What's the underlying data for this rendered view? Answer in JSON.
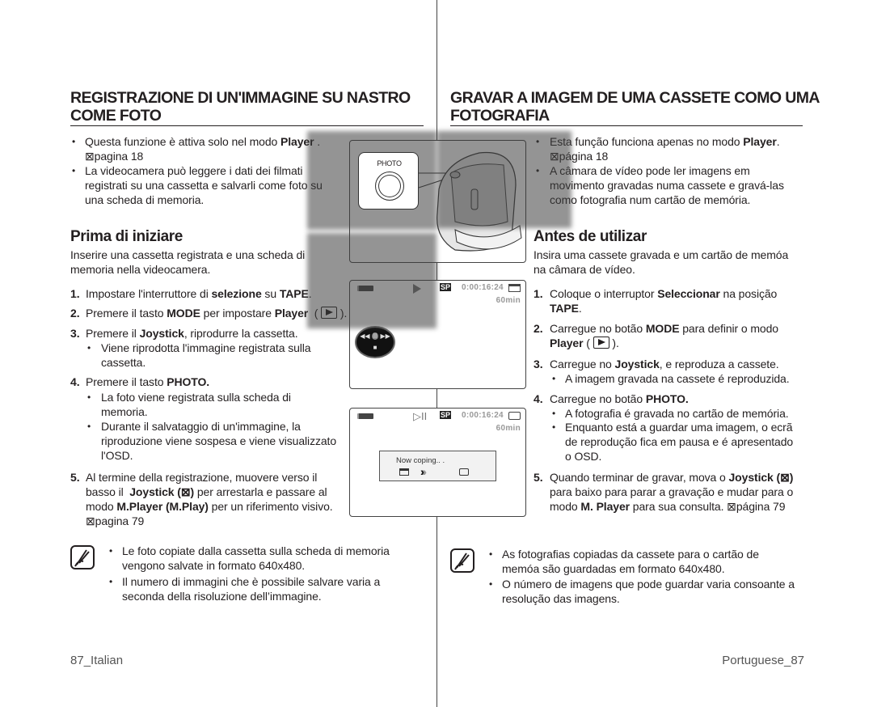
{
  "left": {
    "title": "REGISTRAZIONE DI UN'IMMAGINE SU NASTRO\nCOME FOTO",
    "bullets": [
      [
        {
          "t": "Questa funzione è attiva solo nel modo "
        },
        {
          "t": "Player",
          "b": true
        },
        {
          "t": " .\n⊠pagina 18"
        }
      ],
      [
        {
          "t": "La videocamera può leggere i dati dei filmati\nregistrati su una cassetta e salvarli come foto su\nuna scheda di memoria."
        }
      ]
    ],
    "section_title": "Prima di iniziare",
    "intro": [
      {
        "t": "Inserire una cassetta registrata e una scheda di\nmemoria nella videocamera."
      }
    ],
    "steps": [
      {
        "num": "1.",
        "segs": [
          {
            "t": "Impostare l'interruttore di "
          },
          {
            "t": "selezione",
            "b": true
          },
          {
            "t": " su "
          },
          {
            "t": "TAPE",
            "b": true
          },
          {
            "t": "."
          }
        ]
      },
      {
        "num": "2.",
        "segs": [
          {
            "t": "Premere il tasto "
          },
          {
            "t": "MODE",
            "b": true
          },
          {
            "t": " per impostare "
          },
          {
            "t": "Player",
            "b": true
          },
          {
            "t": "  ( "
          },
          {
            "icon": "play-mode-icon"
          },
          {
            "t": " )."
          }
        ]
      },
      {
        "num": "3.",
        "segs": [
          {
            "t": "Premere il "
          },
          {
            "t": "Joystick",
            "b": true
          },
          {
            "t": ", riprodurre la cassetta."
          }
        ],
        "subs": [
          [
            {
              "t": "Viene riprodotta l'immagine registrata sulla\ncassetta."
            }
          ]
        ]
      },
      {
        "num": "4.",
        "segs": [
          {
            "t": "Premere il tasto "
          },
          {
            "t": "PHOTO.",
            "b": true
          }
        ],
        "subs": [
          [
            {
              "t": "La foto viene registrata sulla scheda di\nmemoria."
            }
          ],
          [
            {
              "t": "Durante il salvataggio di un'immagine, la\nriproduzione viene sospesa e viene visualizzato\nl'OSD."
            }
          ]
        ]
      },
      {
        "num": "5.",
        "segs": [
          {
            "t": "Al termine della registrazione, muovere verso il\nbasso il  "
          },
          {
            "t": "Joystick (⊠)",
            "b": true
          },
          {
            "t": " per arrestarla e passare al\nmodo "
          },
          {
            "t": "M.Player (M.Play)",
            "b": true
          },
          {
            "t": " per un riferimento visivo.\n⊠pagina 79"
          }
        ]
      }
    ],
    "notes": [
      [
        {
          "t": "Le foto copiate dalla cassetta sulla scheda di memoria\nvengono salvate in formato 640x480."
        }
      ],
      [
        {
          "t": "Il numero di immagini che è possibile salvare varia a\nseconda della risoluzione dell’immagine."
        }
      ]
    ],
    "footer": {
      "page": "87",
      "lang": "_Italian"
    }
  },
  "right": {
    "title": "GRAVAR A IMAGEM DE UMA CASSETE COMO UMA\nFOTOGRAFIA",
    "bullets": [
      [
        {
          "t": "Esta função funciona apenas no modo "
        },
        {
          "t": "Player",
          "b": true
        },
        {
          "t": ".\n⊠página 18"
        }
      ],
      [
        {
          "t": "A câmara de vídeo pode ler imagens em\nmovimento gravadas numa cassete e gravá-las\ncomo fotografia num cartão de memória."
        }
      ]
    ],
    "section_title": "Antes de utilizar",
    "intro": [
      {
        "t": "Insira uma cassete gravada e um cartão de memóa\nna câmara de vídeo."
      }
    ],
    "steps": [
      {
        "num": "1.",
        "segs": [
          {
            "t": "Coloque o interruptor "
          },
          {
            "t": "Seleccionar",
            "b": true
          },
          {
            "t": " na posição\n"
          },
          {
            "t": "TAPE",
            "b": true
          },
          {
            "t": "."
          }
        ]
      },
      {
        "num": "2.",
        "segs": [
          {
            "t": "Carregue no botão "
          },
          {
            "t": "MODE",
            "b": true
          },
          {
            "t": " para definir o modo\n"
          },
          {
            "t": "Player",
            "b": true
          },
          {
            "t": " ( "
          },
          {
            "icon": "play-mode-icon"
          },
          {
            "t": " )."
          }
        ]
      },
      {
        "num": "3.",
        "segs": [
          {
            "t": "Carregue no "
          },
          {
            "t": "Joystick",
            "b": true
          },
          {
            "t": ", e reproduza a cassete."
          }
        ],
        "subs": [
          [
            {
              "t": "A imagem gravada na cassete é reproduzida."
            }
          ]
        ]
      },
      {
        "num": "4.",
        "segs": [
          {
            "t": "Carregue no botão "
          },
          {
            "t": "PHOTO.",
            "b": true
          }
        ],
        "subs": [
          [
            {
              "t": "A fotografia é gravada no cartão de memória."
            }
          ],
          [
            {
              "t": "Enquanto está a guardar uma imagem, o ecrã\nde reprodução fica em pausa e é apresentado\no OSD."
            }
          ]
        ]
      },
      {
        "num": "5.",
        "segs": [
          {
            "t": "Quando terminar de gravar, mova o "
          },
          {
            "t": "Joystick (⊠)",
            "b": true
          },
          {
            "t": "\npara baixo para parar a gravação e mudar para o\nmodo "
          },
          {
            "t": "M. Player",
            "b": true
          },
          {
            "t": " para sua consulta. ⊠página 79"
          }
        ]
      }
    ],
    "notes": [
      [
        {
          "t": "As fotografias copiadas da cassete para o cartão de\nmemóa são guardadas em formato 640x480."
        }
      ],
      [
        {
          "t": "O número de imagens que pode guardar varia consoante a\nresolução das imagens."
        }
      ]
    ],
    "footer": {
      "lang": "Portuguese_",
      "page": "87"
    }
  },
  "figures": {
    "photo_button_label": "PHOTO",
    "osd": {
      "time": "0:00:16:24",
      "remaining": "60min",
      "quality": "SP",
      "copy_message": "Now coping.. ."
    }
  }
}
